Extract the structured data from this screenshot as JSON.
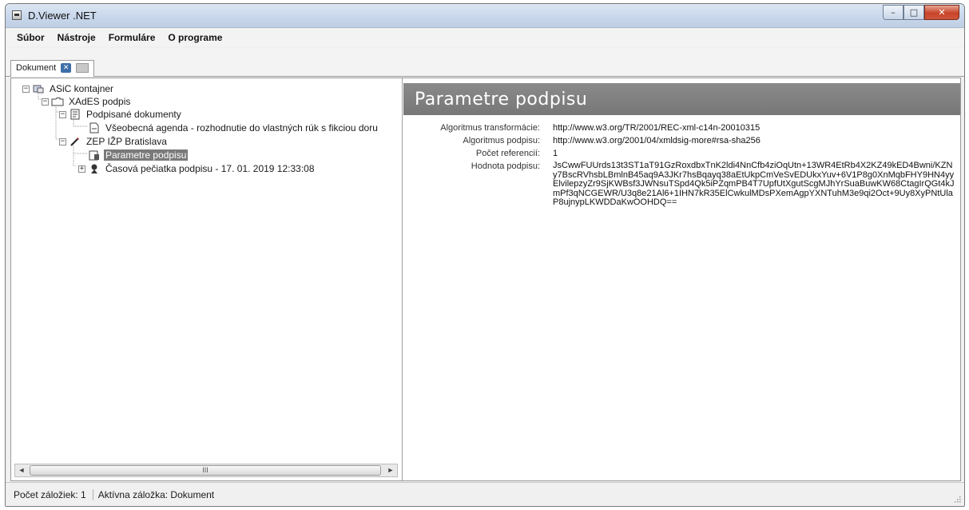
{
  "window": {
    "title": "D.Viewer .NET",
    "min_glyph": "–",
    "max_glyph": "□",
    "close_glyph": "✕"
  },
  "menu": {
    "items": [
      "Súbor",
      "Nástroje",
      "Formuláre",
      "O programe"
    ]
  },
  "tabs": {
    "document_label": "Dokument",
    "close_glyph": "✕"
  },
  "tree": {
    "nodes": [
      {
        "label": "ASiC kontajner",
        "icon": "container-icon",
        "expander": "−"
      },
      {
        "label": "XAdES podpis",
        "icon": "folder-icon",
        "expander": "−"
      },
      {
        "label": "Podpisané dokumenty",
        "icon": "documents-icon",
        "expander": "−"
      },
      {
        "label": "Všeobecná agenda - rozhodnutie do vlastných rúk s fikciou doru",
        "icon": "document-icon",
        "expander": ""
      },
      {
        "label": "ZEP IŽP Bratislava",
        "icon": "pen-icon",
        "expander": "−"
      },
      {
        "label": "Parametre podpisu",
        "icon": "parameters-icon",
        "expander": "",
        "selected": true
      },
      {
        "label": "Časová pečiatka podpisu - 17. 01. 2019 12:33:08",
        "icon": "timestamp-icon",
        "expander": "+"
      }
    ],
    "scrollbar_left": "◄",
    "scrollbar_right": "►",
    "scrollbar_grip": "III"
  },
  "detail": {
    "header": "Parametre podpisu",
    "properties": [
      {
        "key": "Algoritmus transformácie:",
        "value": "http://www.w3.org/TR/2001/REC-xml-c14n-20010315"
      },
      {
        "key": "Algoritmus podpisu:",
        "value": "http://www.w3.org/2001/04/xmldsig-more#rsa-sha256"
      },
      {
        "key": "Počet referencií:",
        "value": "1"
      }
    ],
    "signature": {
      "key": "Hodnota podpisu:",
      "value": "JsCwwFUUrds13t3ST1aT91GzRoxdbxTnK2ldi4NnCfb4ziOqUtn+13WR4EtRb4X2KZ49kED4Bwni/KZNy7BscRVhsbLBmlnB45aq9A3JKr7hsBqayq38aEtUkpCmVeSvEDUkxYuv+6V1P8g0XnMqbFHY9HN4yyElvilepzyZr9SjKWBsf3JWNsuTSpd4Qk5iPZqmPB4T7UpfUtXgutScgMJhYrSuaBuwKW68CtagIrQGt4kJmPf3qNCGEWR/U3q8e21Al6+1IHN7kR35ElCwkulMDsPXemAgpYXNTuhM3e9qi2Oct+9Uy8XyPNtUlaP8ujnypLKWDDaKwOOHDQ=="
    }
  },
  "status": {
    "bookmarks_count": "Počet záložiek: 1",
    "active_bookmark": "Aktívna záložka: Dokument"
  }
}
